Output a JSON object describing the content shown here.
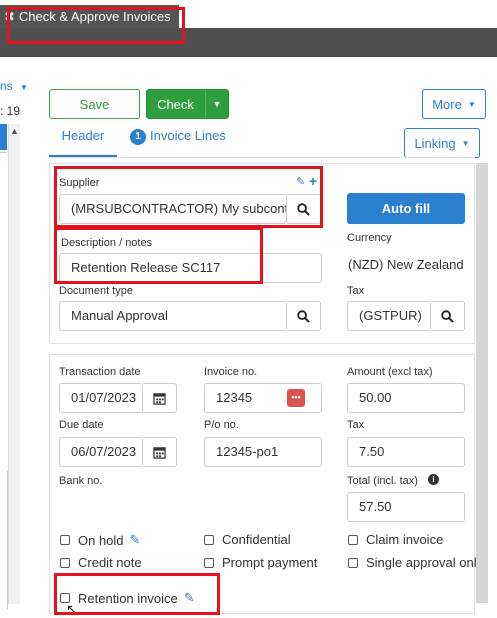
{
  "window": {
    "tab_title": "Check & Approve Invoices",
    "tab_close": "✖"
  },
  "left_column": {
    "partial_label": "ns",
    "partial_count": ": 19"
  },
  "toolbar": {
    "save_label": "Save",
    "check_label": "Check",
    "more_label": "More",
    "linking_label": "Linking"
  },
  "tabs": {
    "header_label": "Header",
    "lines_count": "1",
    "lines_label": "Invoice Lines"
  },
  "supplier": {
    "label": "Supplier",
    "value": "(MRSUBCONTRACTOR) My subcontractor"
  },
  "autofill_label": "Auto fill",
  "currency": {
    "label": "Currency",
    "value": "(NZD) New Zealand Dollar"
  },
  "description": {
    "label": "Description / notes",
    "value": "Retention Release SC117"
  },
  "doc_type": {
    "label": "Document type",
    "value": "Manual Approval"
  },
  "tax_code": {
    "label": "Tax",
    "value": "(GSTPUR)"
  },
  "transaction_date": {
    "label": "Transaction date",
    "value": "01/07/2023"
  },
  "invoice_no": {
    "label": "Invoice no.",
    "value": "12345"
  },
  "amount_excl": {
    "label": "Amount (excl tax)",
    "value": "50.00"
  },
  "due_date": {
    "label": "Due date",
    "value": "06/07/2023"
  },
  "po_no": {
    "label": "P/o no.",
    "value": "12345-po1"
  },
  "tax_amount": {
    "label": "Tax",
    "value": "7.50"
  },
  "bank_no": {
    "label": "Bank no."
  },
  "total_incl": {
    "label": "Total (incl. tax)",
    "value": "57.50"
  },
  "checkboxes": {
    "on_hold": "On hold",
    "confidential": "Confidential",
    "claim_invoice": "Claim invoice",
    "credit_note": "Credit note",
    "prompt_payment": "Prompt payment",
    "single_approval": "Single approval only",
    "retention_invoice": "Retention invoice"
  },
  "colors": {
    "primary": "#2a7fcf",
    "success": "#2e9e3e",
    "highlight": "#e3121b",
    "dark_bar": "#4f4f4f"
  }
}
